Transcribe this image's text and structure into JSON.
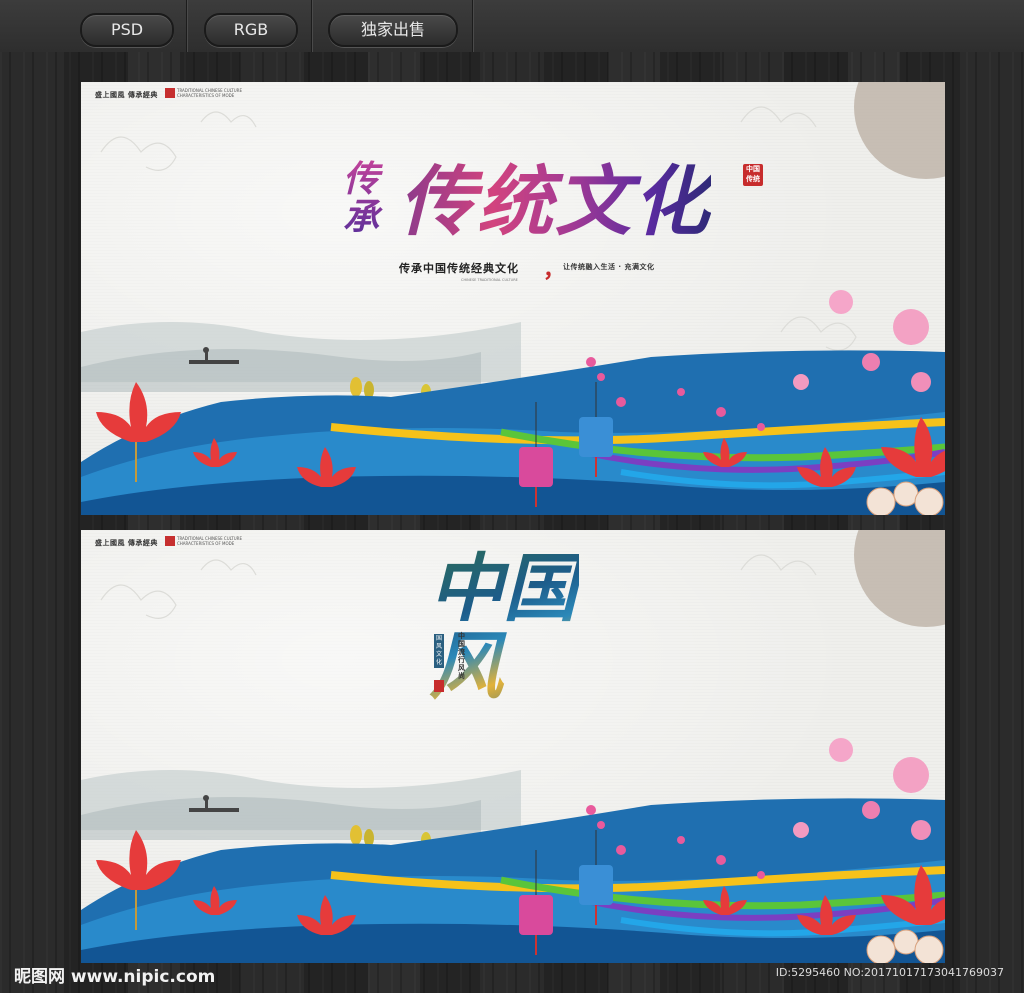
{
  "toolbar": {
    "badges": [
      "PSD",
      "RGB",
      "独家出售"
    ]
  },
  "poster_common": {
    "corner_tag": "盛上國風 傳承經典",
    "corner_eng": "TRADITIONAL CHINESE CULTURE CHARACTERISTICS OF MODE"
  },
  "poster1": {
    "title_side": "传承",
    "title": "传统文化",
    "seal": "中国传统",
    "subtitle": "传承中国传统经典文化",
    "comma": "，",
    "subtitle2": "让传统融入生活 · 充满文化",
    "eng_line": "CHINESE TRADITIONAL CULTURE"
  },
  "poster2": {
    "title": "中国风",
    "vertical_text": "中国流行风尚",
    "box_text": "国风文化"
  },
  "footer": {
    "logo": "昵图网 www.nipic.com",
    "id_text": "ID:5295460 NO:20171017173041769037"
  },
  "colors": {
    "bg": "#262626",
    "poster_paper": "#efefec",
    "river_blue": "#1f6fb0",
    "lotus_red": "#e63b3b",
    "plum_pink": "#e85a9c"
  },
  "icons": [
    "lotus-flower-icon",
    "lantern-icon",
    "plum-blossom-icon",
    "boat-icon",
    "cloud-pattern-icon",
    "tree-icon"
  ]
}
